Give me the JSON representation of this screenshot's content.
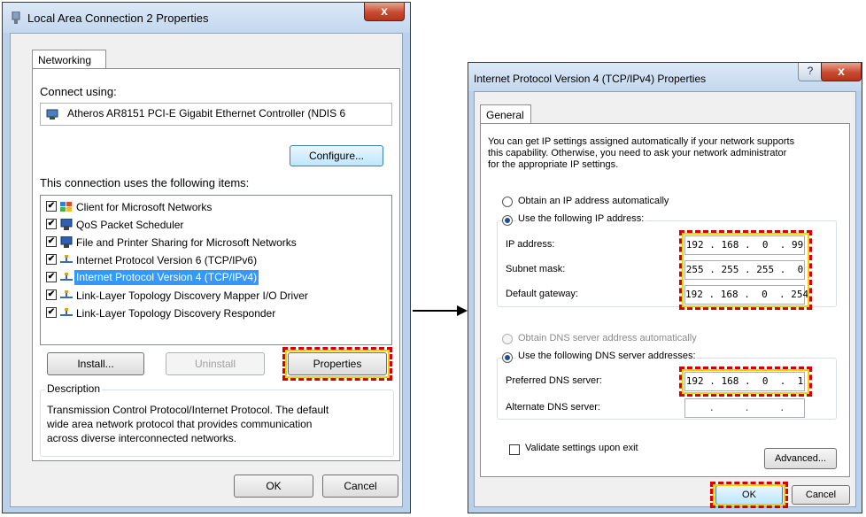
{
  "left_dialog": {
    "title": "Local Area Connection 2 Properties",
    "close_glyph": "x",
    "tab": "Networking",
    "connect_using_label": "Connect using:",
    "adapter_name": "Atheros AR8151 PCI-E Gigabit Ethernet Controller (NDIS 6",
    "configure_button": "Configure...",
    "items_label": "This connection uses the following items:",
    "items": [
      {
        "label": "Client for Microsoft Networks",
        "checked": true,
        "icon": "network-client-icon"
      },
      {
        "label": "QoS Packet Scheduler",
        "checked": true,
        "icon": "network-service-icon"
      },
      {
        "label": "File and Printer Sharing for Microsoft Networks",
        "checked": true,
        "icon": "network-service-icon"
      },
      {
        "label": "Internet Protocol Version 6 (TCP/IPv6)",
        "checked": true,
        "icon": "protocol-icon"
      },
      {
        "label": "Internet Protocol Version 4 (TCP/IPv4)",
        "checked": true,
        "icon": "protocol-icon",
        "selected": true
      },
      {
        "label": "Link-Layer Topology Discovery Mapper I/O Driver",
        "checked": true,
        "icon": "protocol-icon"
      },
      {
        "label": "Link-Layer Topology Discovery Responder",
        "checked": true,
        "icon": "protocol-icon"
      }
    ],
    "install_button": "Install...",
    "uninstall_button": "Uninstall",
    "properties_button": "Properties",
    "description_label": "Description",
    "description_lines": [
      "Transmission Control Protocol/Internet Protocol. The default",
      "wide area network protocol that provides communication",
      "across diverse interconnected networks."
    ],
    "ok_button": "OK",
    "cancel_button": "Cancel"
  },
  "right_dialog": {
    "title": "Internet Protocol Version 4 (TCP/IPv4) Properties",
    "help_glyph": "?",
    "close_glyph": "x",
    "tab": "General",
    "intro_lines": [
      "You can get IP settings assigned automatically if your network supports",
      "this capability. Otherwise, you need to ask your network administrator",
      "for the appropriate IP settings."
    ],
    "obtain_ip_auto": "Obtain an IP address automatically",
    "use_following_ip": "Use the following IP address:",
    "ip_address_label": "IP address:",
    "ip_address_value": "192 . 168 .  0  . 99",
    "subnet_mask_label": "Subnet mask:",
    "subnet_mask_value": "255 . 255 . 255 .  0",
    "gateway_label": "Default gateway:",
    "gateway_value": "192 . 168 .  0  . 254",
    "obtain_dns_auto": "Obtain DNS server address automatically",
    "use_following_dns": "Use the following DNS server addresses:",
    "preferred_dns_label": "Preferred DNS server:",
    "preferred_dns_value": "192 . 168 .  0  .  1",
    "alternate_dns_label": "Alternate DNS server:",
    "alternate_dns_value": "    .     .     .    ",
    "validate_label": "Validate settings upon exit",
    "advanced_button": "Advanced...",
    "ok_button": "OK",
    "cancel_button": "Cancel"
  },
  "colors": {
    "highlight_box": "#d40000",
    "highlight_outline": "#f5d000",
    "selection": "#3399ff"
  }
}
